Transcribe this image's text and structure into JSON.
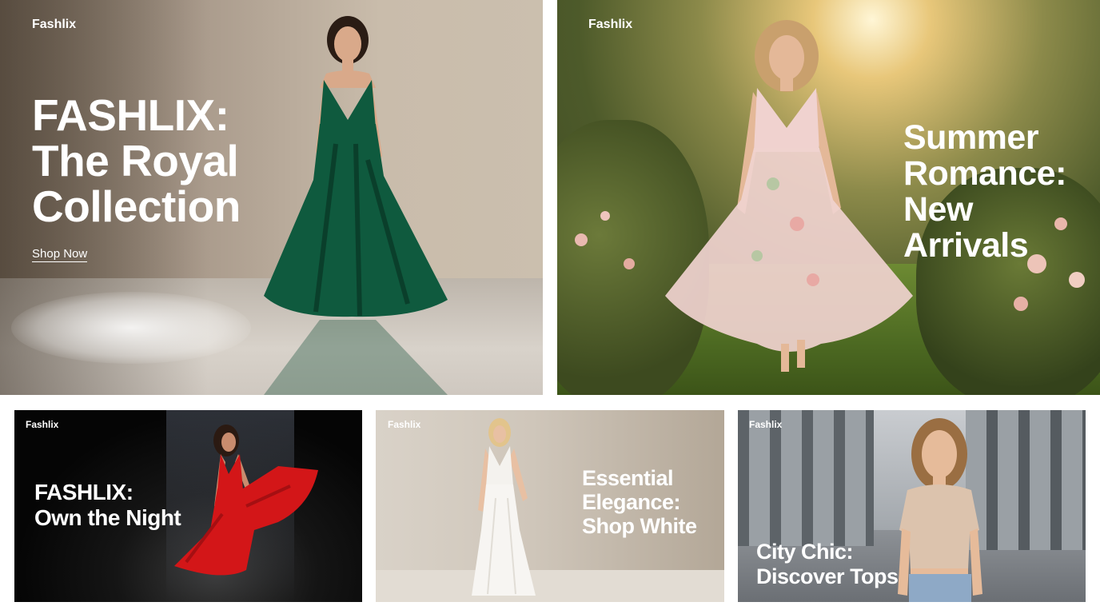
{
  "brand": "Fashlix",
  "banners": [
    {
      "headline": [
        "FASHLIX:",
        "The Royal",
        "Collection"
      ],
      "cta": "Shop Now",
      "dress_color": "#0f5a3e"
    },
    {
      "headline": [
        "Summer",
        "Romance:",
        "New",
        "Arrivals"
      ],
      "dress_color": "#f0d2cf"
    },
    {
      "headline": [
        "FASHLIX:",
        "Own the Night"
      ],
      "dress_color": "#d31618"
    },
    {
      "headline": [
        "Essential",
        "Elegance:",
        "Shop White"
      ],
      "dress_color": "#f4f2ee"
    },
    {
      "headline": [
        "City Chic:",
        "Discover Tops"
      ],
      "top_color": "#dcc3ad",
      "jeans_color": "#8ea9c6"
    }
  ]
}
